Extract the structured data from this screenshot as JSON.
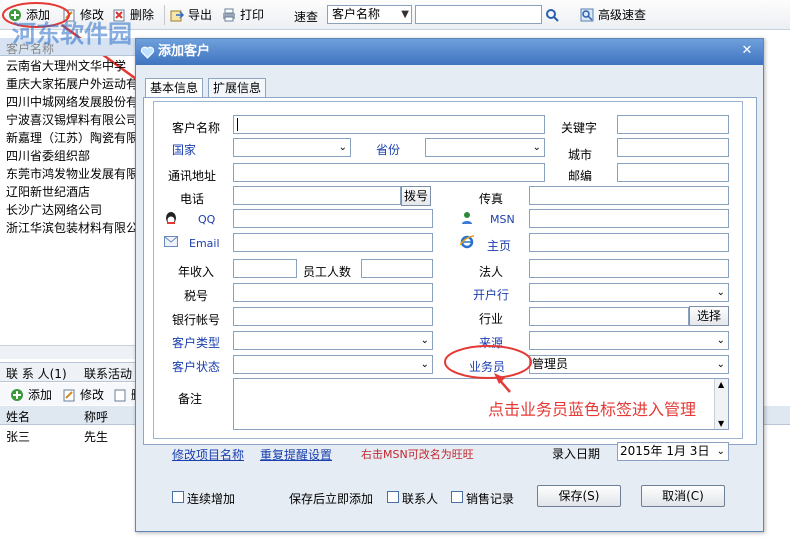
{
  "toolbar": {
    "add": "添加",
    "edit": "修改",
    "delete": "删除",
    "export": "导出",
    "print": "打印",
    "search_label": "速查",
    "search_field": "客户名称",
    "advanced_search": "高级速查"
  },
  "background": {
    "list_header": "客户名称",
    "rows": [
      "云南省大理州文华中学",
      "重庆大家拓展户外运动有",
      "四川中城网络发展股份有",
      "宁波喜汉锡焊料有限公司",
      "新嘉理（江苏）陶瓷有限",
      "四川省委组织部",
      "东莞市鸿发物业发展有限",
      "辽阳新世纪酒店",
      "长沙广达网络公司",
      "浙江华滨包装材料有限公"
    ],
    "tabs": [
      "联 系 人(1)",
      "联系活动"
    ],
    "sub_add": "添加",
    "sub_edit": "修改",
    "sub_delete": "删",
    "columns": [
      "姓名",
      "称呼"
    ],
    "contacts": [
      {
        "name": "张三",
        "title": "先生"
      }
    ]
  },
  "watermark": "河东软件园",
  "dialog": {
    "title": "添加客户",
    "tabs": [
      "基本信息",
      "扩展信息"
    ],
    "labels": {
      "customer_name": "客户名称",
      "keyword": "关键字",
      "country": "国家",
      "province": "省份",
      "city": "城市",
      "address": "通讯地址",
      "zip": "邮编",
      "phone": "电话",
      "dial": "拨号",
      "fax": "传真",
      "qq": "QQ",
      "msn": "MSN",
      "email": "Email",
      "homepage": "主页",
      "annual_income": "年收入",
      "employees": "员工人数",
      "legal_person": "法人",
      "tax_no": "税号",
      "bank": "开户行",
      "bank_account": "银行帐号",
      "industry": "行业",
      "select": "选择",
      "customer_type": "客户类型",
      "source": "来源",
      "customer_status": "客户状态",
      "salesperson": "业务员",
      "notes": "备注",
      "entry_date": "录入日期"
    },
    "values": {
      "salesperson": "管理员",
      "entry_date": "2015年 1月 3日"
    },
    "links": {
      "edit_names": "修改项目名称",
      "reminder": "重复提醒设置",
      "msn_tip": "右击MSN可改名为旺旺"
    },
    "options": {
      "continuous_add": "连续增加",
      "after_save": "保存后立即添加",
      "contact": "联系人",
      "sales_record": "销售记录"
    },
    "buttons": {
      "save": "保存(S)",
      "cancel": "取消(C)"
    }
  },
  "annotation": "点击业务员蓝色标签进入管理",
  "colors": {
    "title_bar": "#3e73bf",
    "label_blue": "#1a3fae",
    "annotation_red": "#e53935"
  }
}
